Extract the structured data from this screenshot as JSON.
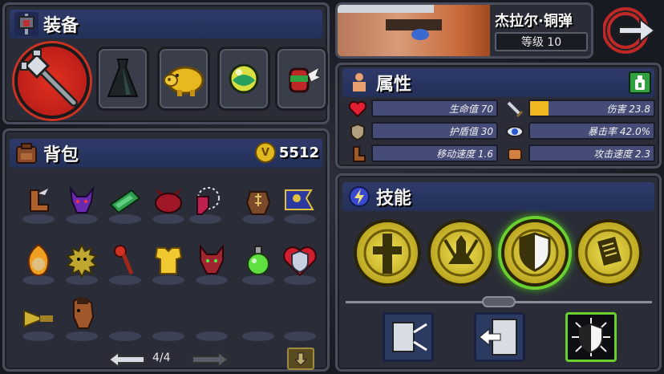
{
  "equipment": {
    "title": "装备"
  },
  "backpack": {
    "title": "背包",
    "gold": "5512",
    "page": "4/4"
  },
  "character": {
    "name": "杰拉尔·铜弹",
    "level": "等级 10"
  },
  "attributes": {
    "title": "属性",
    "stats": [
      {
        "label": "生命值",
        "value": "70",
        "icon": "heart-icon",
        "fill": 0
      },
      {
        "label": "伤害",
        "value": "23.8",
        "icon": "sword-icon",
        "fill": 0.15
      },
      {
        "label": "护盾值",
        "value": "30",
        "icon": "shield-icon",
        "fill": 0
      },
      {
        "label": "暴击率",
        "value": "42.0%",
        "icon": "eye-icon",
        "fill": 0
      },
      {
        "label": "移动速度",
        "value": "1.6",
        "icon": "boot-icon",
        "fill": 0
      },
      {
        "label": "攻击速度",
        "value": "2.3",
        "icon": "fist-icon",
        "fill": 0
      }
    ]
  },
  "skills": {
    "title": "技能"
  },
  "colors": {
    "accent": "#2f3a6a",
    "gold": "#e0c020",
    "heart": "#e02030",
    "highlight": "#6ad030"
  }
}
